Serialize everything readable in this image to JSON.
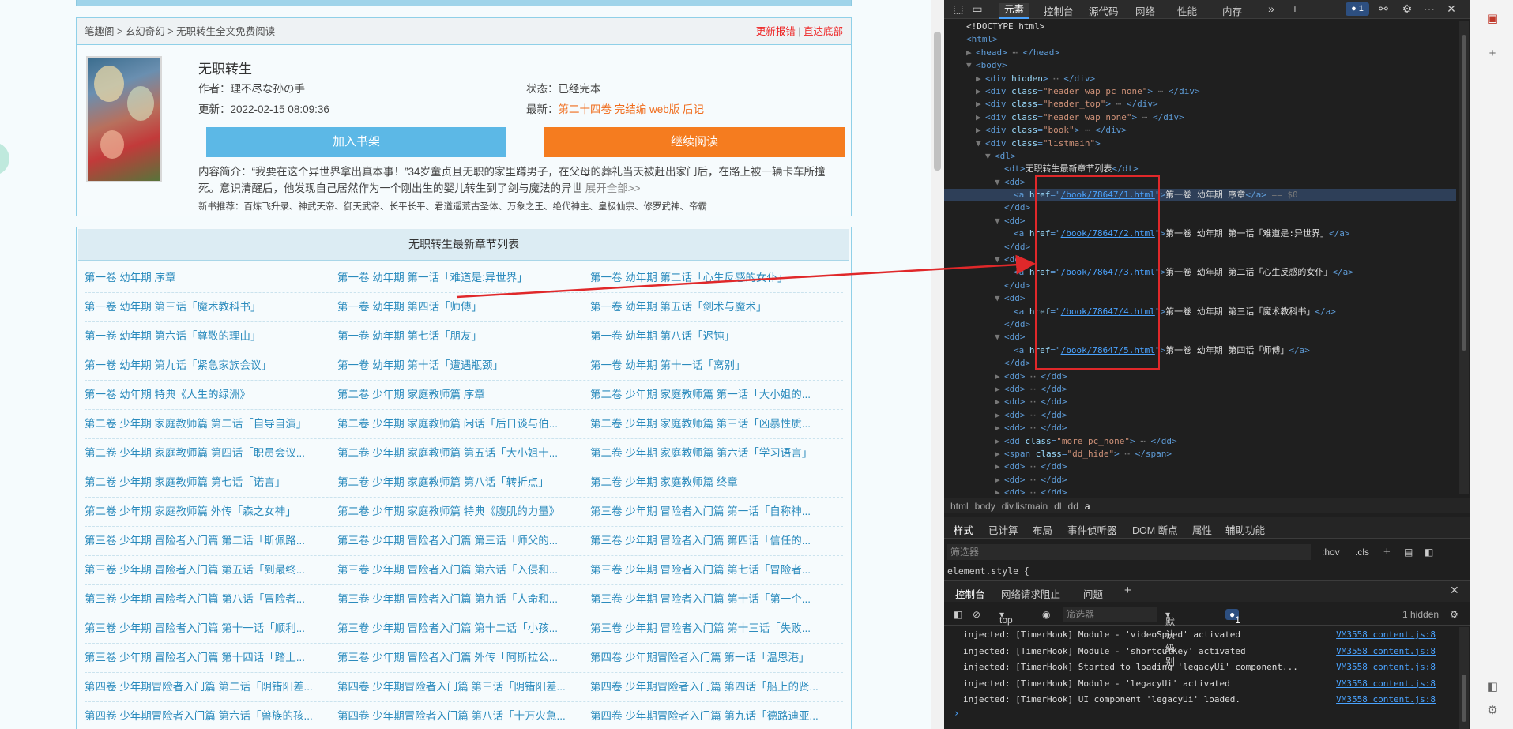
{
  "breadcrumb": {
    "site": "笔趣阁",
    "sep1": ">",
    "cat": "玄幻奇幻",
    "sep2": ">",
    "page": "无职转生全文免费阅读",
    "report": "更新报错",
    "divider": "|",
    "bottom": "直达底部"
  },
  "book": {
    "title": "无职转生",
    "author_label": "作者：",
    "author": "理不尽な孙の手",
    "status_label": "状态：",
    "status": "已经完本",
    "update_label": "更新：",
    "update": "2022-02-15 08:09:36",
    "latest_label": "最新：",
    "latest": "第二十四卷 完结编 web版 后记",
    "btn_shelf": "加入书架",
    "btn_read": "继续阅读",
    "intro": "内容简介：“我要在这个异世界拿出真本事！”34岁童贞且无职的家里蹲男子，在父母的葬礼当天被赶出家门后，在路上被一辆卡车所撞死。意识清醒后，他发现自己居然作为一个刚出生的婴儿转生到了剑与魔法的异世",
    "intro_more": "展开全部>>",
    "recommend": "新书推荐：百炼飞升录、神武天帝、御天武帝、长平长平、君道遥荒古圣体、万象之王、绝代神主、皇极仙宗、修罗武神、帝霸"
  },
  "chapter_list": {
    "heading": "无职转生最新章节列表",
    "rows": [
      [
        "第一卷 幼年期 序章",
        "第一卷 幼年期 第一话「难道是:异世界」",
        "第一卷 幼年期 第二话「心生反感的女仆」"
      ],
      [
        "第一卷 幼年期 第三话「魔术教科书」",
        "第一卷 幼年期 第四话「师傅」",
        "第一卷 幼年期 第五话「剑术与魔术」"
      ],
      [
        "第一卷 幼年期 第六话「尊敬的理由」",
        "第一卷 幼年期 第七话「朋友」",
        "第一卷 幼年期 第八话「迟钝」"
      ],
      [
        "第一卷 幼年期 第九话「紧急家族会议」",
        "第一卷 幼年期 第十话「遭遇瓶颈」",
        "第一卷 幼年期 第十一话「离别」"
      ],
      [
        "第一卷 幼年期 特典《人生的绿洲》",
        "第二卷 少年期 家庭教师篇 序章",
        "第二卷 少年期 家庭教师篇 第一话「大小姐的..."
      ],
      [
        "第二卷 少年期 家庭教师篇 第二话「自导自演」",
        "第二卷 少年期 家庭教师篇 闲话「后日谈与伯...",
        "第二卷 少年期 家庭教师篇 第三话「凶暴性质..."
      ],
      [
        "第二卷 少年期 家庭教师篇 第四话「职员会议...",
        "第二卷 少年期 家庭教师篇 第五话「大小姐十...",
        "第二卷 少年期 家庭教师篇 第六话「学习语言」"
      ],
      [
        "第二卷 少年期 家庭教师篇 第七话「诺言」",
        "第二卷 少年期 家庭教师篇 第八话「转折点」",
        "第二卷 少年期 家庭教师篇 终章"
      ],
      [
        "第二卷 少年期 家庭教师篇 外传「森之女神」",
        "第二卷 少年期 家庭教师篇 特典《腹肌的力量》",
        "第三卷 少年期 冒险者入门篇 第一话「自称神..."
      ],
      [
        "第三卷 少年期 冒险者入门篇 第二话「斯佩路...",
        "第三卷 少年期 冒险者入门篇 第三话「师父的...",
        "第三卷 少年期 冒险者入门篇 第四话「信任的..."
      ],
      [
        "第三卷 少年期 冒险者入门篇 第五话「到最终...",
        "第三卷 少年期 冒险者入门篇 第六话「入侵和...",
        "第三卷 少年期 冒险者入门篇 第七话「冒险者..."
      ],
      [
        "第三卷 少年期 冒险者入门篇 第八话「冒险者...",
        "第三卷 少年期 冒险者入门篇 第九话「人命和...",
        "第三卷 少年期 冒险者入门篇 第十话「第一个..."
      ],
      [
        "第三卷 少年期 冒险者入门篇 第十一话「顺利...",
        "第三卷 少年期 冒险者入门篇 第十二话「小孩...",
        "第三卷 少年期 冒险者入门篇 第十三话「失败..."
      ],
      [
        "第三卷 少年期 冒险者入门篇 第十四话「踏上...",
        "第三卷 少年期 冒险者入门篇 外传「阿斯拉公...",
        "第四卷 少年期冒险者入门篇 第一话「温恩港」"
      ],
      [
        "第四卷 少年期冒险者入门篇 第二话「阴错阳差...",
        "第四卷 少年期冒险者入门篇 第三话「阴错阳差...",
        "第四卷 少年期冒险者入门篇 第四话「船上的贤..."
      ],
      [
        "第四卷 少年期冒险者入门篇 第六话「兽族的孩...",
        "第四卷 少年期冒险者入门篇 第八话「十万火急...",
        "第四卷 少年期冒险者入门篇 第九话「德路迪亚..."
      ]
    ]
  },
  "devtools": {
    "tabs": [
      "元素",
      "控制台",
      "源代码",
      "网络",
      "性能",
      "内存"
    ],
    "issues_count": "1",
    "dom_lines": [
      {
        "indent": 0,
        "caret": "",
        "parts": [
          [
            "txt",
            "<!DOCTYPE html>"
          ]
        ]
      },
      {
        "indent": 0,
        "caret": "",
        "parts": [
          [
            "tag",
            "<html>"
          ]
        ]
      },
      {
        "indent": 1,
        "caret": "▶",
        "parts": [
          [
            "tag",
            "<head>"
          ],
          [
            "dim",
            " ⋯ "
          ],
          [
            "tag",
            "</head>"
          ]
        ]
      },
      {
        "indent": 1,
        "caret": "▼",
        "parts": [
          [
            "tag",
            "<body>"
          ]
        ]
      },
      {
        "indent": 2,
        "caret": "▶",
        "parts": [
          [
            "tag",
            "<div "
          ],
          [
            "attr",
            "hidden"
          ],
          [
            "tag",
            ">"
          ],
          [
            "dim",
            " ⋯ "
          ],
          [
            "tag",
            "</div>"
          ]
        ]
      },
      {
        "indent": 2,
        "caret": "▶",
        "parts": [
          [
            "tag",
            "<div "
          ],
          [
            "attr",
            "class"
          ],
          [
            "tag",
            "="
          ],
          [
            "val",
            "\"header_wap pc_none\""
          ],
          [
            "tag",
            ">"
          ],
          [
            "dim",
            " ⋯ "
          ],
          [
            "tag",
            "</div>"
          ]
        ]
      },
      {
        "indent": 2,
        "caret": "▶",
        "parts": [
          [
            "tag",
            "<div "
          ],
          [
            "attr",
            "class"
          ],
          [
            "tag",
            "="
          ],
          [
            "val",
            "\"header_top\""
          ],
          [
            "tag",
            ">"
          ],
          [
            "dim",
            " ⋯ "
          ],
          [
            "tag",
            "</div>"
          ]
        ]
      },
      {
        "indent": 2,
        "caret": "▶",
        "parts": [
          [
            "tag",
            "<div "
          ],
          [
            "attr",
            "class"
          ],
          [
            "tag",
            "="
          ],
          [
            "val",
            "\"header wap_none\""
          ],
          [
            "tag",
            ">"
          ],
          [
            "dim",
            " ⋯ "
          ],
          [
            "tag",
            "</div>"
          ]
        ]
      },
      {
        "indent": 2,
        "caret": "▶",
        "parts": [
          [
            "tag",
            "<div "
          ],
          [
            "attr",
            "class"
          ],
          [
            "tag",
            "="
          ],
          [
            "val",
            "\"book\""
          ],
          [
            "tag",
            ">"
          ],
          [
            "dim",
            " ⋯ "
          ],
          [
            "tag",
            "</div>"
          ]
        ]
      },
      {
        "indent": 2,
        "caret": "▼",
        "parts": [
          [
            "tag",
            "<div "
          ],
          [
            "attr",
            "class"
          ],
          [
            "tag",
            "="
          ],
          [
            "val",
            "\"listmain\""
          ],
          [
            "tag",
            ">"
          ]
        ]
      },
      {
        "indent": 3,
        "caret": "▼",
        "parts": [
          [
            "tag",
            "<dl>"
          ]
        ]
      },
      {
        "indent": 4,
        "caret": "",
        "parts": [
          [
            "tag",
            "<dt>"
          ],
          [
            "txt",
            "无职转生最新章节列表"
          ],
          [
            "tag",
            "</dt>"
          ]
        ]
      },
      {
        "indent": 4,
        "caret": "▼",
        "parts": [
          [
            "tag",
            "<dd>"
          ]
        ]
      },
      {
        "indent": 5,
        "caret": "",
        "sel": true,
        "parts": [
          [
            "tag",
            "<a "
          ],
          [
            "attr",
            "href"
          ],
          [
            "tag",
            "=\""
          ],
          [
            "link",
            "/book/78647/1.html"
          ],
          [
            "tag",
            "\">"
          ],
          [
            "txt",
            "第一卷 幼年期 序章"
          ],
          [
            "tag",
            "</a>"
          ],
          [
            "dim",
            " == $0"
          ]
        ]
      },
      {
        "indent": 4,
        "caret": "",
        "parts": [
          [
            "tag",
            "</dd>"
          ]
        ]
      },
      {
        "indent": 4,
        "caret": "▼",
        "parts": [
          [
            "tag",
            "<dd>"
          ]
        ]
      },
      {
        "indent": 5,
        "caret": "",
        "parts": [
          [
            "tag",
            "<a "
          ],
          [
            "attr",
            "href"
          ],
          [
            "tag",
            "=\""
          ],
          [
            "link",
            "/book/78647/2.html"
          ],
          [
            "tag",
            "\">"
          ],
          [
            "txt",
            "第一卷 幼年期 第一话「难道是:异世界」"
          ],
          [
            "tag",
            "</a>"
          ]
        ]
      },
      {
        "indent": 4,
        "caret": "",
        "parts": [
          [
            "tag",
            "</dd>"
          ]
        ]
      },
      {
        "indent": 4,
        "caret": "▼",
        "parts": [
          [
            "tag",
            "<dd>"
          ]
        ]
      },
      {
        "indent": 5,
        "caret": "",
        "parts": [
          [
            "tag",
            "<a "
          ],
          [
            "attr",
            "href"
          ],
          [
            "tag",
            "=\""
          ],
          [
            "link",
            "/book/78647/3.html"
          ],
          [
            "tag",
            "\">"
          ],
          [
            "txt",
            "第一卷 幼年期 第二话「心生反感的女仆」"
          ],
          [
            "tag",
            "</a>"
          ]
        ]
      },
      {
        "indent": 4,
        "caret": "",
        "parts": [
          [
            "tag",
            "</dd>"
          ]
        ]
      },
      {
        "indent": 4,
        "caret": "▼",
        "parts": [
          [
            "tag",
            "<dd>"
          ]
        ]
      },
      {
        "indent": 5,
        "caret": "",
        "parts": [
          [
            "tag",
            "<a "
          ],
          [
            "attr",
            "href"
          ],
          [
            "tag",
            "=\""
          ],
          [
            "link",
            "/book/78647/4.html"
          ],
          [
            "tag",
            "\">"
          ],
          [
            "txt",
            "第一卷 幼年期 第三话「魔术教科书」"
          ],
          [
            "tag",
            "</a>"
          ]
        ]
      },
      {
        "indent": 4,
        "caret": "",
        "parts": [
          [
            "tag",
            "</dd>"
          ]
        ]
      },
      {
        "indent": 4,
        "caret": "▼",
        "parts": [
          [
            "tag",
            "<dd>"
          ]
        ]
      },
      {
        "indent": 5,
        "caret": "",
        "parts": [
          [
            "tag",
            "<a "
          ],
          [
            "attr",
            "href"
          ],
          [
            "tag",
            "=\""
          ],
          [
            "link",
            "/book/78647/5.html"
          ],
          [
            "tag",
            "\">"
          ],
          [
            "txt",
            "第一卷 幼年期 第四话「师傅」"
          ],
          [
            "tag",
            "</a>"
          ]
        ]
      },
      {
        "indent": 4,
        "caret": "",
        "parts": [
          [
            "tag",
            "</dd>"
          ]
        ]
      },
      {
        "indent": 4,
        "caret": "▶",
        "parts": [
          [
            "tag",
            "<dd>"
          ],
          [
            "dim",
            " ⋯ "
          ],
          [
            "tag",
            "</dd>"
          ]
        ]
      },
      {
        "indent": 4,
        "caret": "▶",
        "parts": [
          [
            "tag",
            "<dd>"
          ],
          [
            "dim",
            " ⋯ "
          ],
          [
            "tag",
            "</dd>"
          ]
        ]
      },
      {
        "indent": 4,
        "caret": "▶",
        "parts": [
          [
            "tag",
            "<dd>"
          ],
          [
            "dim",
            " ⋯ "
          ],
          [
            "tag",
            "</dd>"
          ]
        ]
      },
      {
        "indent": 4,
        "caret": "▶",
        "parts": [
          [
            "tag",
            "<dd>"
          ],
          [
            "dim",
            " ⋯ "
          ],
          [
            "tag",
            "</dd>"
          ]
        ]
      },
      {
        "indent": 4,
        "caret": "▶",
        "parts": [
          [
            "tag",
            "<dd>"
          ],
          [
            "dim",
            " ⋯ "
          ],
          [
            "tag",
            "</dd>"
          ]
        ]
      },
      {
        "indent": 4,
        "caret": "▶",
        "parts": [
          [
            "tag",
            "<dd "
          ],
          [
            "attr",
            "class"
          ],
          [
            "tag",
            "="
          ],
          [
            "val",
            "\"more pc_none\""
          ],
          [
            "tag",
            ">"
          ],
          [
            "dim",
            " ⋯ "
          ],
          [
            "tag",
            "</dd>"
          ]
        ]
      },
      {
        "indent": 4,
        "caret": "▶",
        "parts": [
          [
            "tag",
            "<span "
          ],
          [
            "attr",
            "class"
          ],
          [
            "tag",
            "="
          ],
          [
            "val",
            "\"dd_hide\""
          ],
          [
            "tag",
            ">"
          ],
          [
            "dim",
            " ⋯ "
          ],
          [
            "tag",
            "</span>"
          ]
        ]
      },
      {
        "indent": 4,
        "caret": "▶",
        "parts": [
          [
            "tag",
            "<dd>"
          ],
          [
            "dim",
            " ⋯ "
          ],
          [
            "tag",
            "</dd>"
          ]
        ]
      },
      {
        "indent": 4,
        "caret": "▶",
        "parts": [
          [
            "tag",
            "<dd>"
          ],
          [
            "dim",
            " ⋯ "
          ],
          [
            "tag",
            "</dd>"
          ]
        ]
      },
      {
        "indent": 4,
        "caret": "▶",
        "parts": [
          [
            "tag",
            "<dd>"
          ],
          [
            "dim",
            " ⋯ "
          ],
          [
            "tag",
            "</dd>"
          ]
        ]
      }
    ],
    "crumbs": [
      "html",
      "body",
      "div.listmain",
      "dl",
      "dd",
      "a"
    ],
    "style_tabs": [
      "样式",
      "已计算",
      "布局",
      "事件侦听器",
      "DOM 断点",
      "属性",
      "辅助功能"
    ],
    "filter_placeholder": "筛选器",
    "hov": ":hov",
    "cls": ".cls",
    "element_style": "element.style {",
    "console_tabs": [
      "控制台",
      "网络请求阻止",
      "问题"
    ],
    "console_context": "top",
    "console_filter": "筛选器",
    "console_level": "默认级别",
    "console_badge": "1",
    "hidden_count": "1 hidden",
    "logs": [
      {
        "text": "injected: [TimerHook] Module - 'videoSpeed' activated",
        "src": "VM3558 content.js:8"
      },
      {
        "text": "injected: [TimerHook] Module - 'shortcutKey' activated",
        "src": "VM3558 content.js:8"
      },
      {
        "text": "injected: [TimerHook] Started to loading 'legacyUi' component...",
        "src": "VM3558 content.js:8"
      },
      {
        "text": "injected: [TimerHook] Module - 'legacyUi' activated",
        "src": "VM3558 content.js:8"
      },
      {
        "text": "injected: [TimerHook] UI component 'legacyUi' loaded.",
        "src": "VM3558 content.js:8"
      }
    ],
    "prompt": "›"
  },
  "colors": {
    "link": "#2b8bbd",
    "accent_orange": "#f57c1f",
    "accent_blue": "#5cb8e6",
    "annotation_red": "#e0282a"
  }
}
